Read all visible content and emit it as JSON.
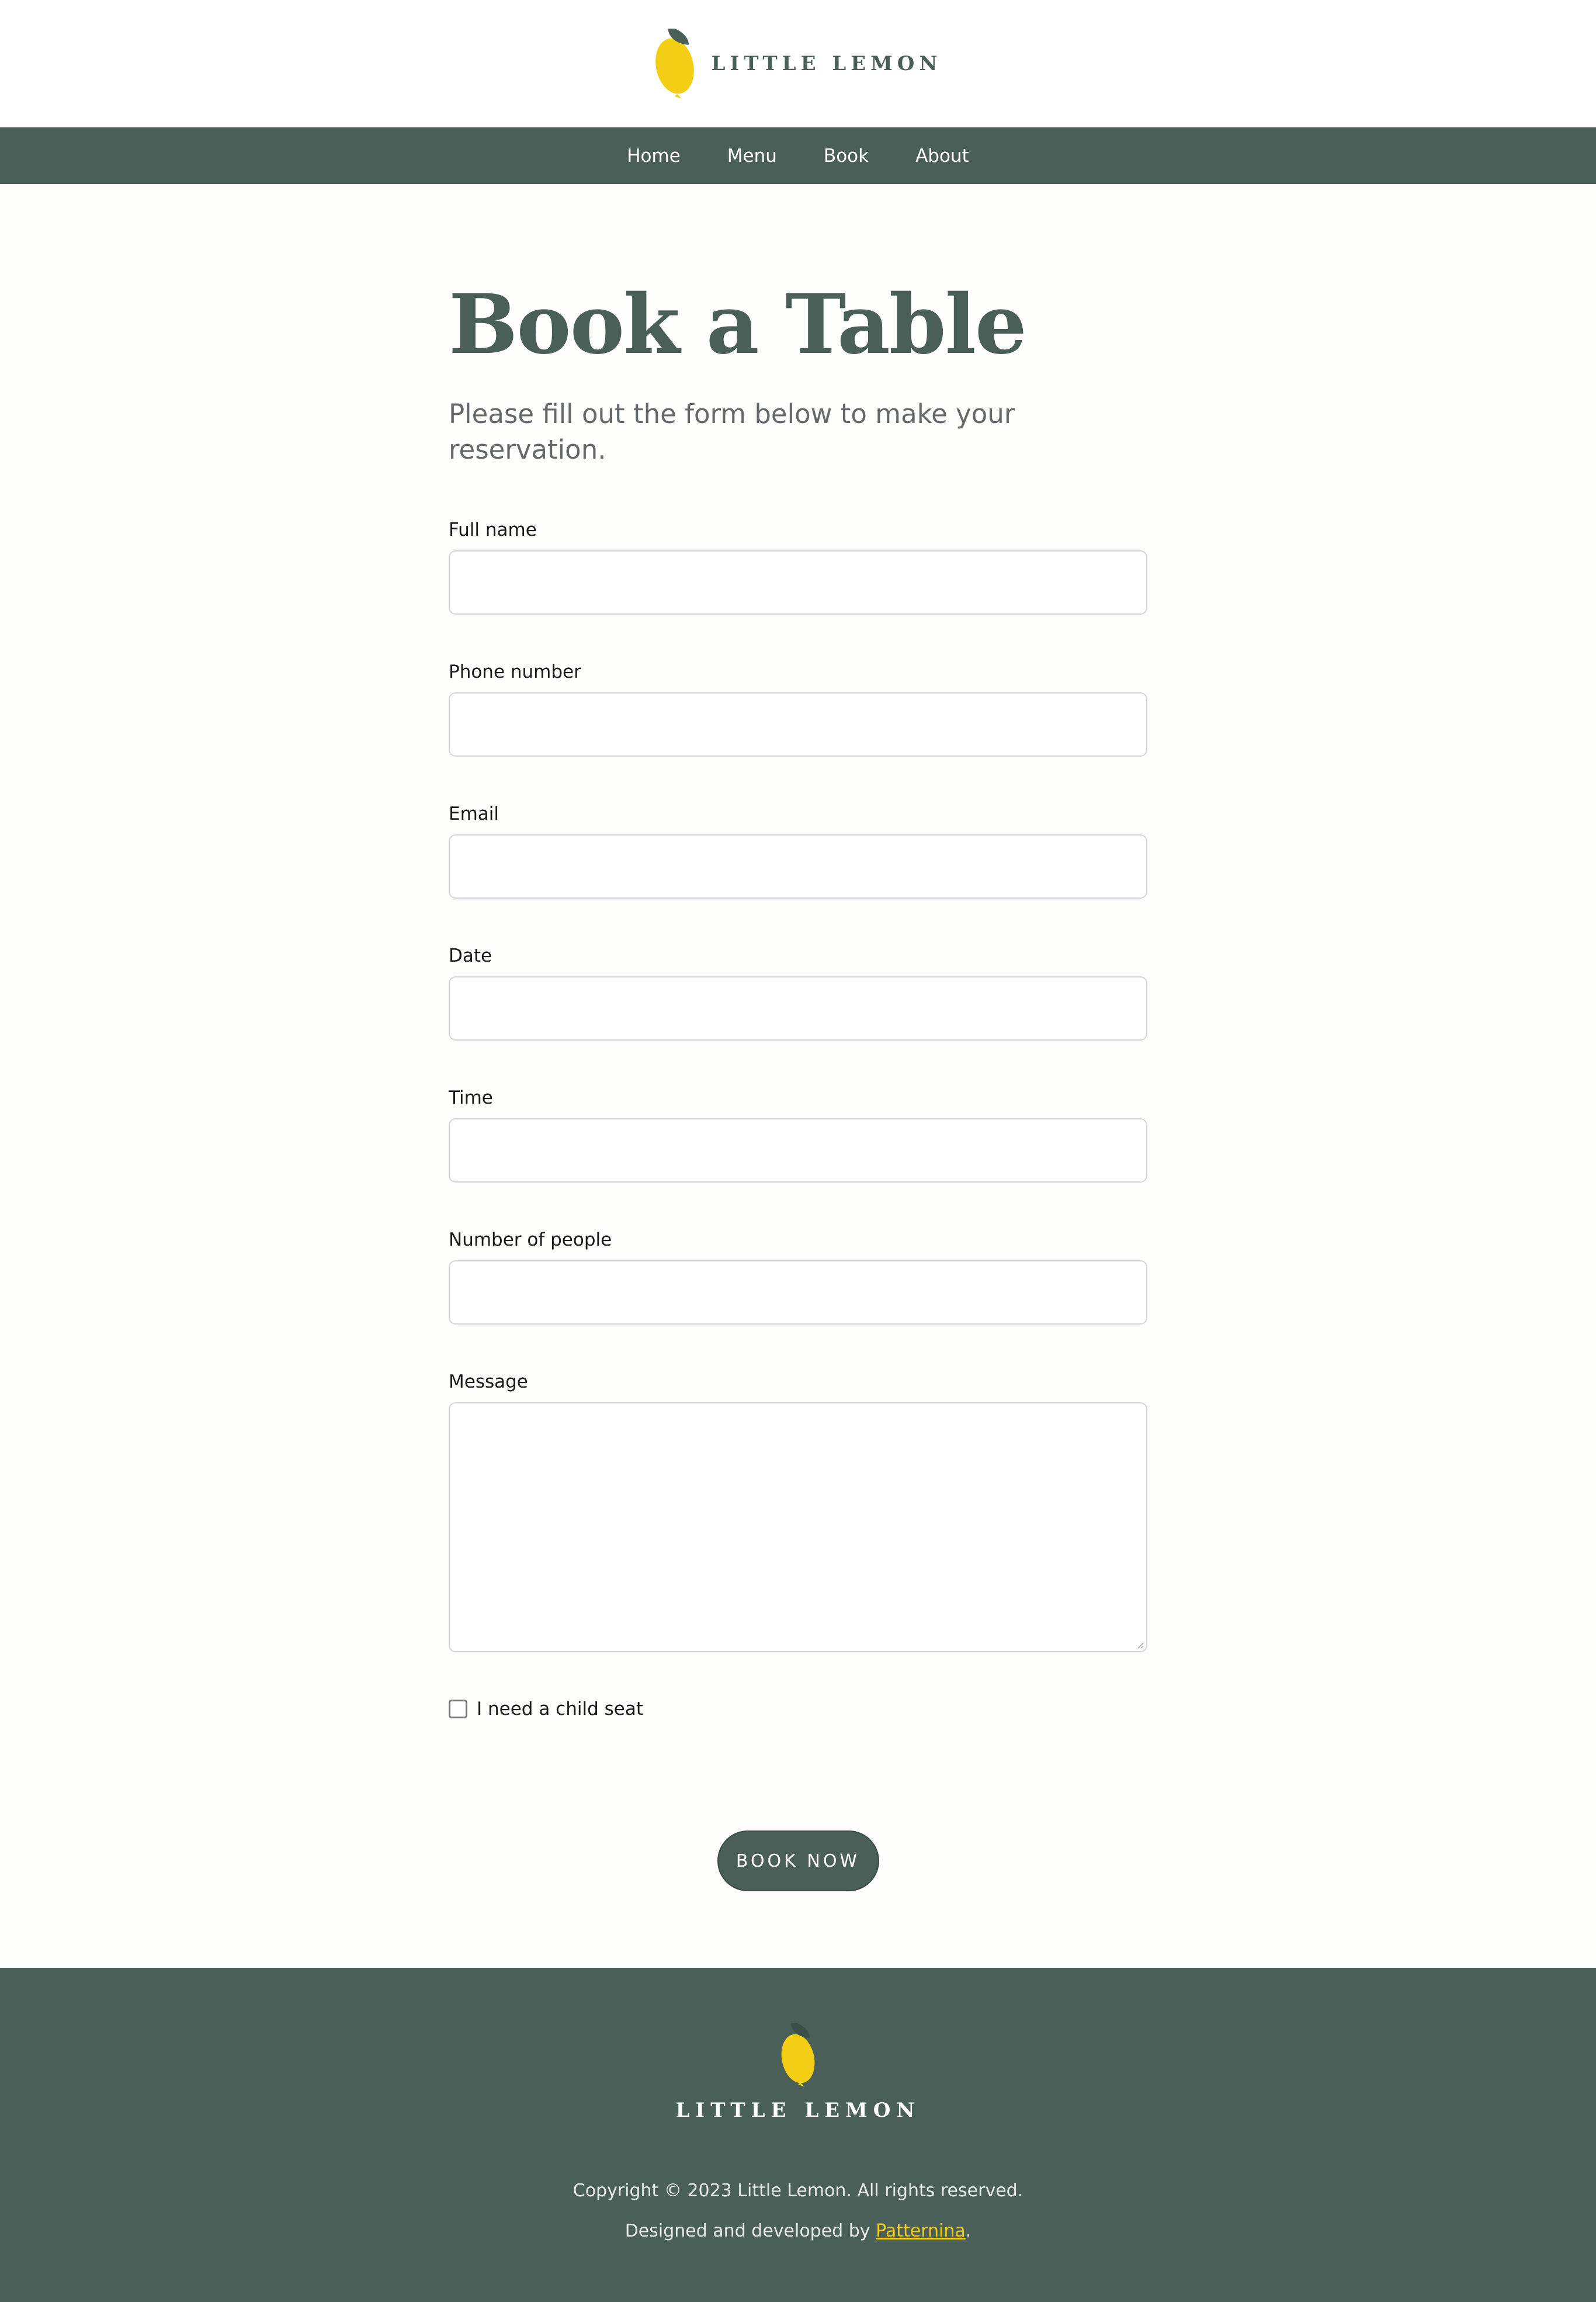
{
  "brand": {
    "name": "LITTLE LEMON",
    "logo_icon": "lemon-icon",
    "colors": {
      "primary": "#4a5f58",
      "lemon": "#f4ce14",
      "leaf": "#4a5f58"
    }
  },
  "nav": {
    "items": [
      {
        "label": "Home"
      },
      {
        "label": "Menu"
      },
      {
        "label": "Book"
      },
      {
        "label": "About"
      }
    ]
  },
  "page": {
    "title": "Book a Table",
    "subtitle": "Please fill out the form below to make your reservation."
  },
  "form": {
    "full_name": {
      "label": "Full name",
      "value": ""
    },
    "phone": {
      "label": "Phone number",
      "value": ""
    },
    "email": {
      "label": "Email",
      "value": ""
    },
    "date": {
      "label": "Date",
      "value": ""
    },
    "time": {
      "label": "Time",
      "value": ""
    },
    "people": {
      "label": "Number of people",
      "value": ""
    },
    "message": {
      "label": "Message",
      "value": ""
    },
    "child_seat": {
      "label": "I need a child seat",
      "checked": false
    },
    "submit_label": "BOOK NOW"
  },
  "footer": {
    "brand_name": "LITTLE LEMON",
    "copyright": "Copyright © 2023 Little Lemon. All rights reserved.",
    "credit_prefix": "Designed and developed by ",
    "credit_link": "Patternina",
    "credit_suffix": "."
  }
}
